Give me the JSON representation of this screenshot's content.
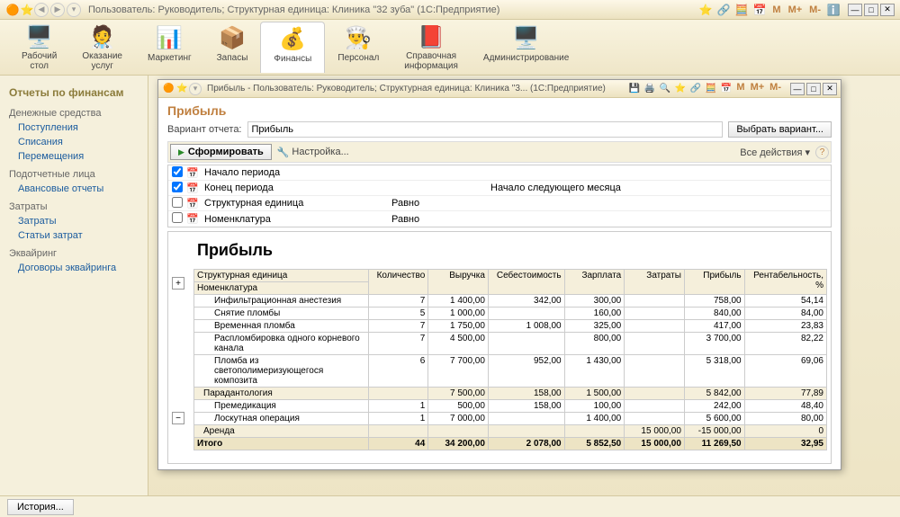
{
  "main": {
    "title": "Пользователь: Руководитель;  Структурная единица: Клиника \"32 зуба\"  (1С:Предприятие)"
  },
  "toolbar": [
    {
      "label": "Рабочий\nстол",
      "icon": "🖥️"
    },
    {
      "label": "Оказание\nуслуг",
      "icon": "🧑‍⚕️"
    },
    {
      "label": "Маркетинг",
      "icon": "📊"
    },
    {
      "label": "Запасы",
      "icon": "📦"
    },
    {
      "label": "Финансы",
      "icon": "💰",
      "active": true
    },
    {
      "label": "Персонал",
      "icon": "👨‍🍳"
    },
    {
      "label": "Справочная\nинформация",
      "icon": "📕"
    },
    {
      "label": "Администрирование",
      "icon": "🖥️"
    }
  ],
  "sidebar": {
    "heading": "Отчеты по финансам",
    "sections": [
      {
        "title": "Денежные средства",
        "items": [
          "Поступления",
          "Списания",
          "Перемещения"
        ]
      },
      {
        "title": "Подотчетные лица",
        "items": [
          "Авансовые отчеты"
        ]
      },
      {
        "title": "Затраты",
        "items": [
          "Затраты",
          "Статьи затрат"
        ]
      },
      {
        "title": "Эквайринг",
        "items": [
          "Договоры эквайринга"
        ]
      }
    ]
  },
  "inner": {
    "title": "Прибыль - Пользователь: Руководитель;  Структурная единица: Клиника \"3...  (1С:Предприятие)",
    "report_title": "Прибыль",
    "variant_label": "Вариант отчета:",
    "variant_value": "Прибыль",
    "choose_variant": "Выбрать вариант...",
    "form_btn": "Сформировать",
    "settings": "Настройка...",
    "all_actions": "Все действия ▾",
    "help": "?"
  },
  "params": [
    {
      "checked": true,
      "name": "Начало периода",
      "cond": "",
      "val": ""
    },
    {
      "checked": true,
      "name": "Конец периода",
      "cond": "",
      "val": "Начало следующего месяца"
    },
    {
      "checked": false,
      "name": "Структурная единица",
      "cond": "Равно",
      "val": ""
    },
    {
      "checked": false,
      "name": "Номенклатура",
      "cond": "Равно",
      "val": ""
    }
  ],
  "report": {
    "heading": "Прибыль",
    "header1": "Структурная единица",
    "header2": "Номенклатура",
    "cols": [
      "Количество",
      "Выручка",
      "Себестоимость",
      "Зарплата",
      "Затраты",
      "Прибыль",
      "Рентабельность, %"
    ],
    "rows": [
      {
        "name": "Инфильтрационная анестезия",
        "qty": "7",
        "rev": "1 400,00",
        "cost": "342,00",
        "sal": "300,00",
        "exp": "",
        "prof": "758,00",
        "rent": "54,14"
      },
      {
        "name": "Снятие пломбы",
        "qty": "5",
        "rev": "1 000,00",
        "cost": "",
        "sal": "160,00",
        "exp": "",
        "prof": "840,00",
        "rent": "84,00"
      },
      {
        "name": "Временная пломба",
        "qty": "7",
        "rev": "1 750,00",
        "cost": "1 008,00",
        "sal": "325,00",
        "exp": "",
        "prof": "417,00",
        "rent": "23,83"
      },
      {
        "name": "Распломбировка одного корневого канала",
        "qty": "7",
        "rev": "4 500,00",
        "cost": "",
        "sal": "800,00",
        "exp": "",
        "prof": "3 700,00",
        "rent": "82,22"
      },
      {
        "name": "Пломба из светополимеризующегося композита",
        "qty": "6",
        "rev": "7 700,00",
        "cost": "952,00",
        "sal": "1 430,00",
        "exp": "",
        "prof": "5 318,00",
        "rent": "69,06"
      },
      {
        "name": "Парадантология",
        "qty": "",
        "rev": "7 500,00",
        "cost": "158,00",
        "sal": "1 500,00",
        "exp": "",
        "prof": "5 842,00",
        "rent": "77,89",
        "group": true
      },
      {
        "name": "Премедикация",
        "qty": "1",
        "rev": "500,00",
        "cost": "158,00",
        "sal": "100,00",
        "exp": "",
        "prof": "242,00",
        "rent": "48,40"
      },
      {
        "name": "Лоскутная операция",
        "qty": "1",
        "rev": "7 000,00",
        "cost": "",
        "sal": "1 400,00",
        "exp": "",
        "prof": "5 600,00",
        "rent": "80,00"
      },
      {
        "name": "Аренда",
        "qty": "",
        "rev": "",
        "cost": "",
        "sal": "",
        "exp": "15 000,00",
        "prof": "-15 000,00",
        "rent": "0",
        "group": true
      }
    ],
    "total_label": "Итого",
    "total": {
      "qty": "44",
      "rev": "34 200,00",
      "cost": "2 078,00",
      "sal": "5 852,50",
      "exp": "15 000,00",
      "prof": "11 269,50",
      "rent": "32,95"
    }
  },
  "status": {
    "history": "История..."
  }
}
